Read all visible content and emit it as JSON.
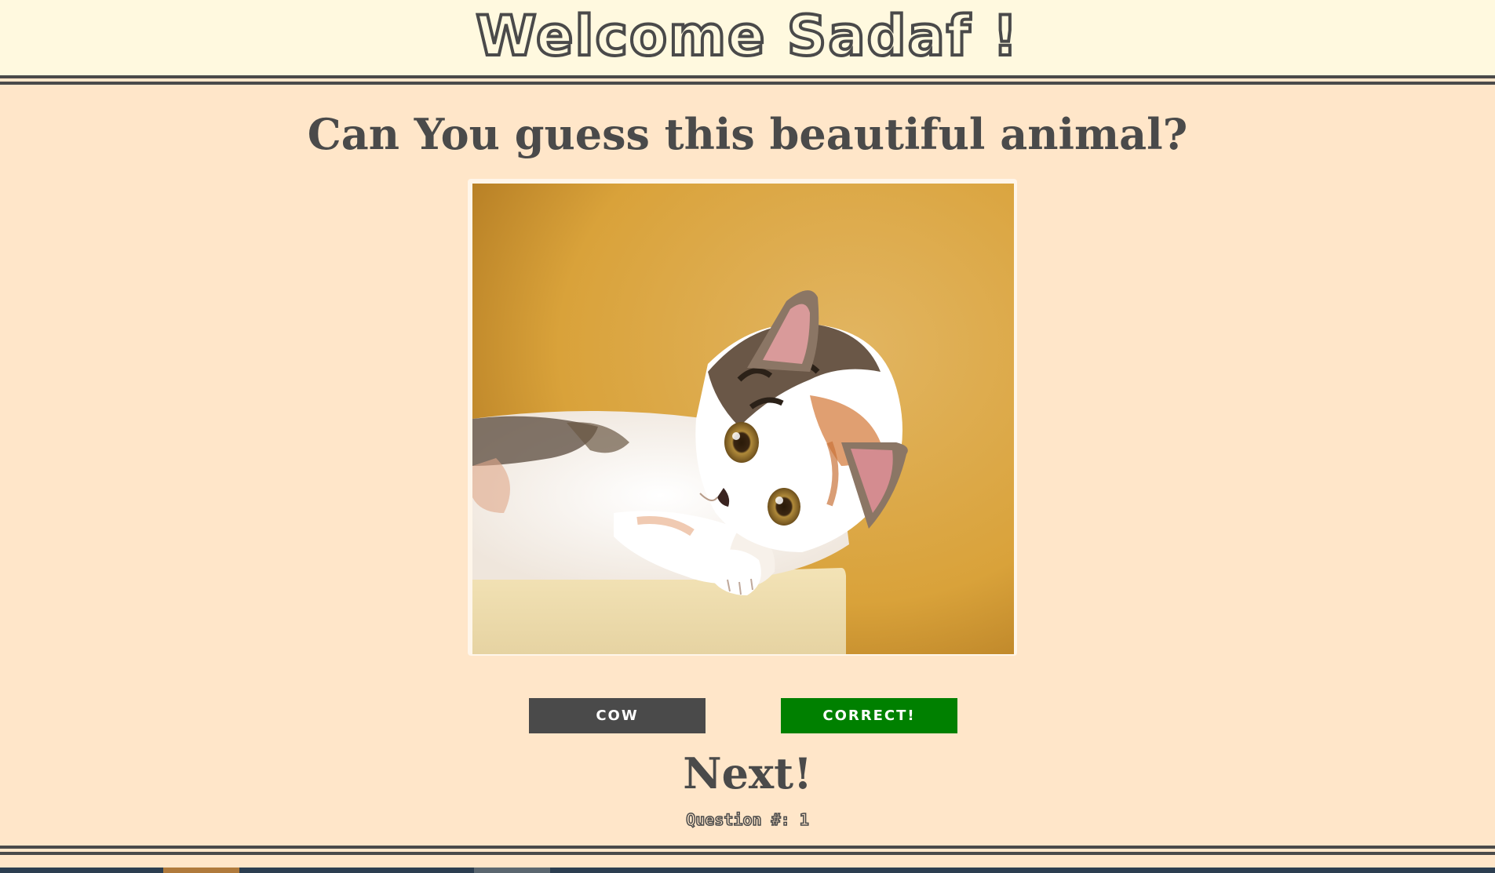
{
  "header": {
    "title": "Welcome Sadaf !"
  },
  "quiz": {
    "question": "Can You guess this beautiful animal?",
    "answers": [
      {
        "label": "COW",
        "state": "neutral",
        "color": "#4a4a4a"
      },
      {
        "label": "CORRECT!",
        "state": "correct",
        "color": "#008000"
      }
    ],
    "next_label": "Next!",
    "counter_label": "Question #: 1"
  },
  "theme": {
    "background": "#ffe6c9",
    "header_background": "#fff9df",
    "text": "#4a4a4a"
  }
}
